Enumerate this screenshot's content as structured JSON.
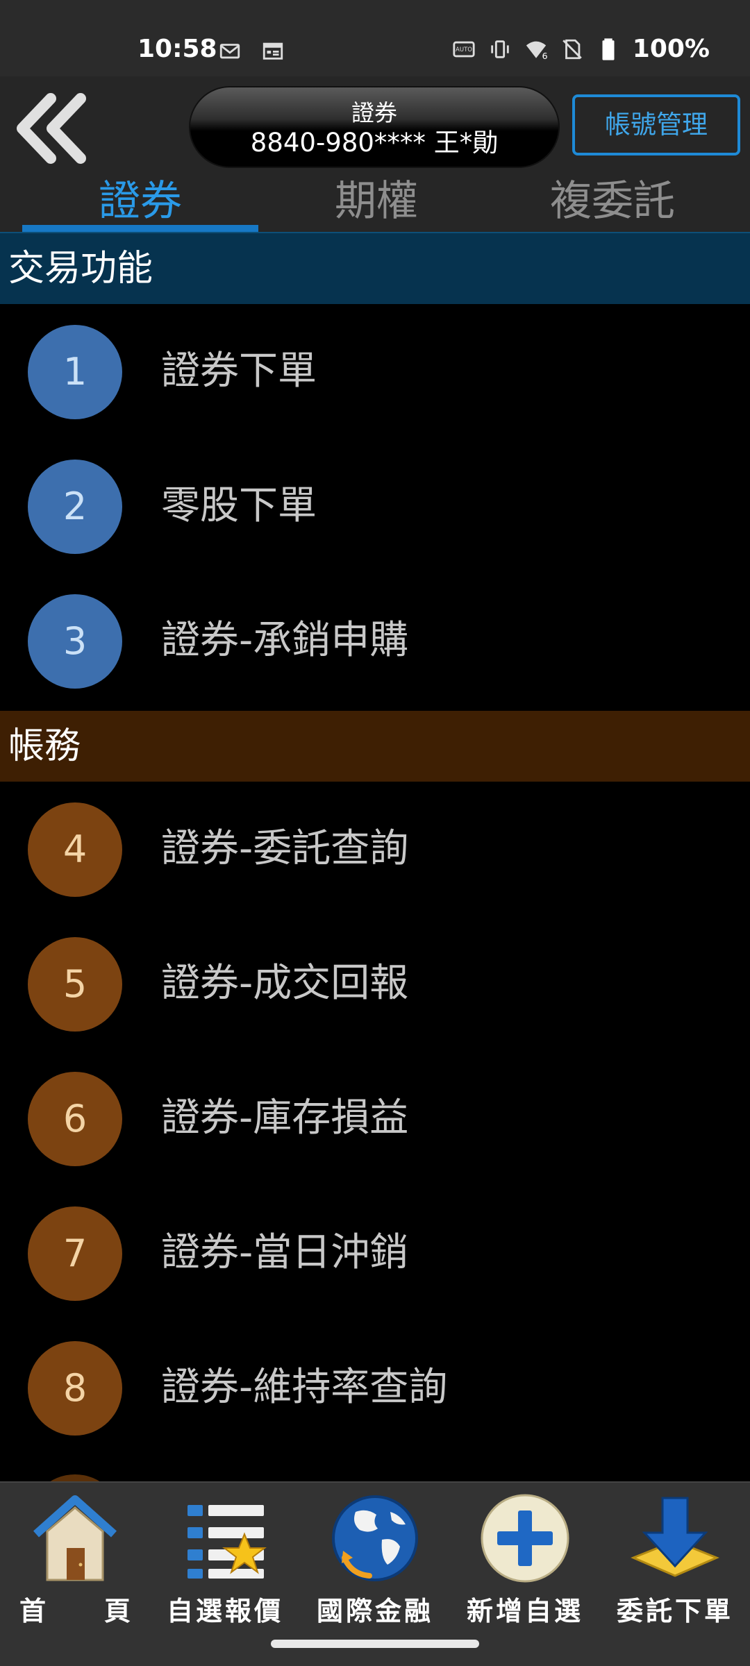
{
  "status_bar": {
    "time": "10:58",
    "battery": "100%"
  },
  "header": {
    "account_type": "證券",
    "account_number": "8840-980**** 王*勛",
    "account_mgmt_label": "帳號管理",
    "tabs": [
      {
        "label": "證券",
        "active": true
      },
      {
        "label": "期權",
        "active": false
      },
      {
        "label": "複委託",
        "active": false
      }
    ]
  },
  "sections": {
    "trading": {
      "title": "交易功能",
      "items": [
        {
          "num": "1",
          "label": "證券下單"
        },
        {
          "num": "2",
          "label": "零股下單"
        },
        {
          "num": "3",
          "label": "證券-承銷申購"
        }
      ]
    },
    "account": {
      "title": "帳務",
      "items": [
        {
          "num": "4",
          "label": "證券-委託查詢"
        },
        {
          "num": "5",
          "label": "證券-成交回報"
        },
        {
          "num": "6",
          "label": "證券-庫存損益"
        },
        {
          "num": "7",
          "label": "證券-當日沖銷"
        },
        {
          "num": "8",
          "label": "證券-維持率查詢"
        }
      ]
    }
  },
  "bottom_nav": {
    "items": [
      {
        "label_a": "首",
        "label_b": "頁",
        "icon": "home-icon"
      },
      {
        "label": "自選報價",
        "icon": "watchlist-icon"
      },
      {
        "label": "國際金融",
        "icon": "globe-icon"
      },
      {
        "label": "新增自選",
        "icon": "add-icon"
      },
      {
        "label": "委託下單",
        "icon": "download-arrow-icon"
      }
    ]
  },
  "colors": {
    "accent": "#2a9ae8",
    "trading_header": "#06334f",
    "account_header": "#3e1f03",
    "circle_blue": "#3d6fae",
    "circle_brown": "#7c4311"
  }
}
